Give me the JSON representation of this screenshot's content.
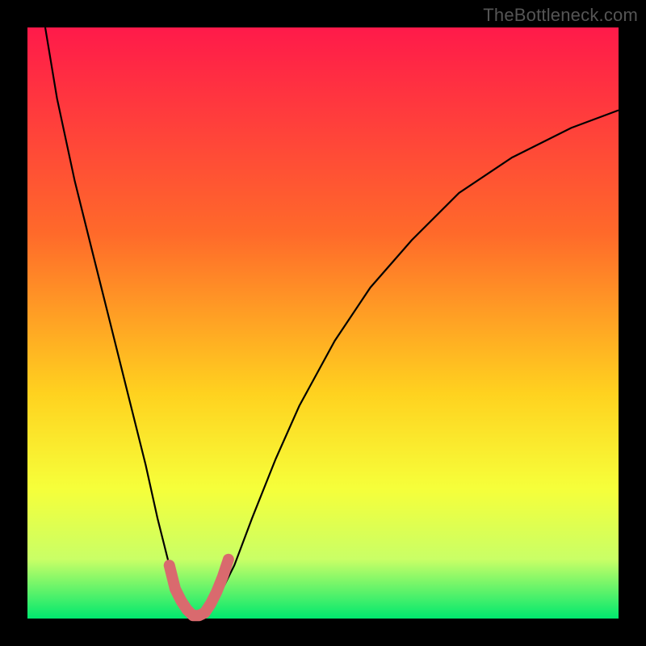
{
  "watermark": "TheBottleneck.com",
  "chart_data": {
    "type": "line",
    "title": "",
    "xlabel": "",
    "ylabel": "",
    "xlim": [
      0,
      100
    ],
    "ylim": [
      0,
      100
    ],
    "series": [
      {
        "name": "bottleneck-curve",
        "x": [
          3,
          5,
          8,
          11,
          14,
          17,
          20,
          22,
          24,
          26,
          28,
          30,
          32,
          35,
          38,
          42,
          46,
          52,
          58,
          65,
          73,
          82,
          92,
          100
        ],
        "y": [
          100,
          88,
          74,
          62,
          50,
          38,
          26,
          17,
          9,
          3,
          0,
          0,
          3,
          9,
          17,
          27,
          36,
          47,
          56,
          64,
          72,
          78,
          83,
          86
        ]
      },
      {
        "name": "optimal-marker",
        "x": [
          24,
          25,
          26,
          27,
          28,
          29,
          30,
          31,
          32,
          33,
          34
        ],
        "y": [
          9,
          5,
          3,
          1.5,
          0.5,
          0.5,
          1,
          2.5,
          4.5,
          7,
          10
        ]
      }
    ],
    "background_gradient": {
      "top": "#ff1a4a",
      "mid1": "#ff6a2a",
      "mid2": "#ffd21f",
      "mid3": "#f6ff3a",
      "mid4": "#c9ff66",
      "bottom": "#00e86e"
    },
    "marker_color": "#d96a6e",
    "curve_color": "#000000"
  }
}
